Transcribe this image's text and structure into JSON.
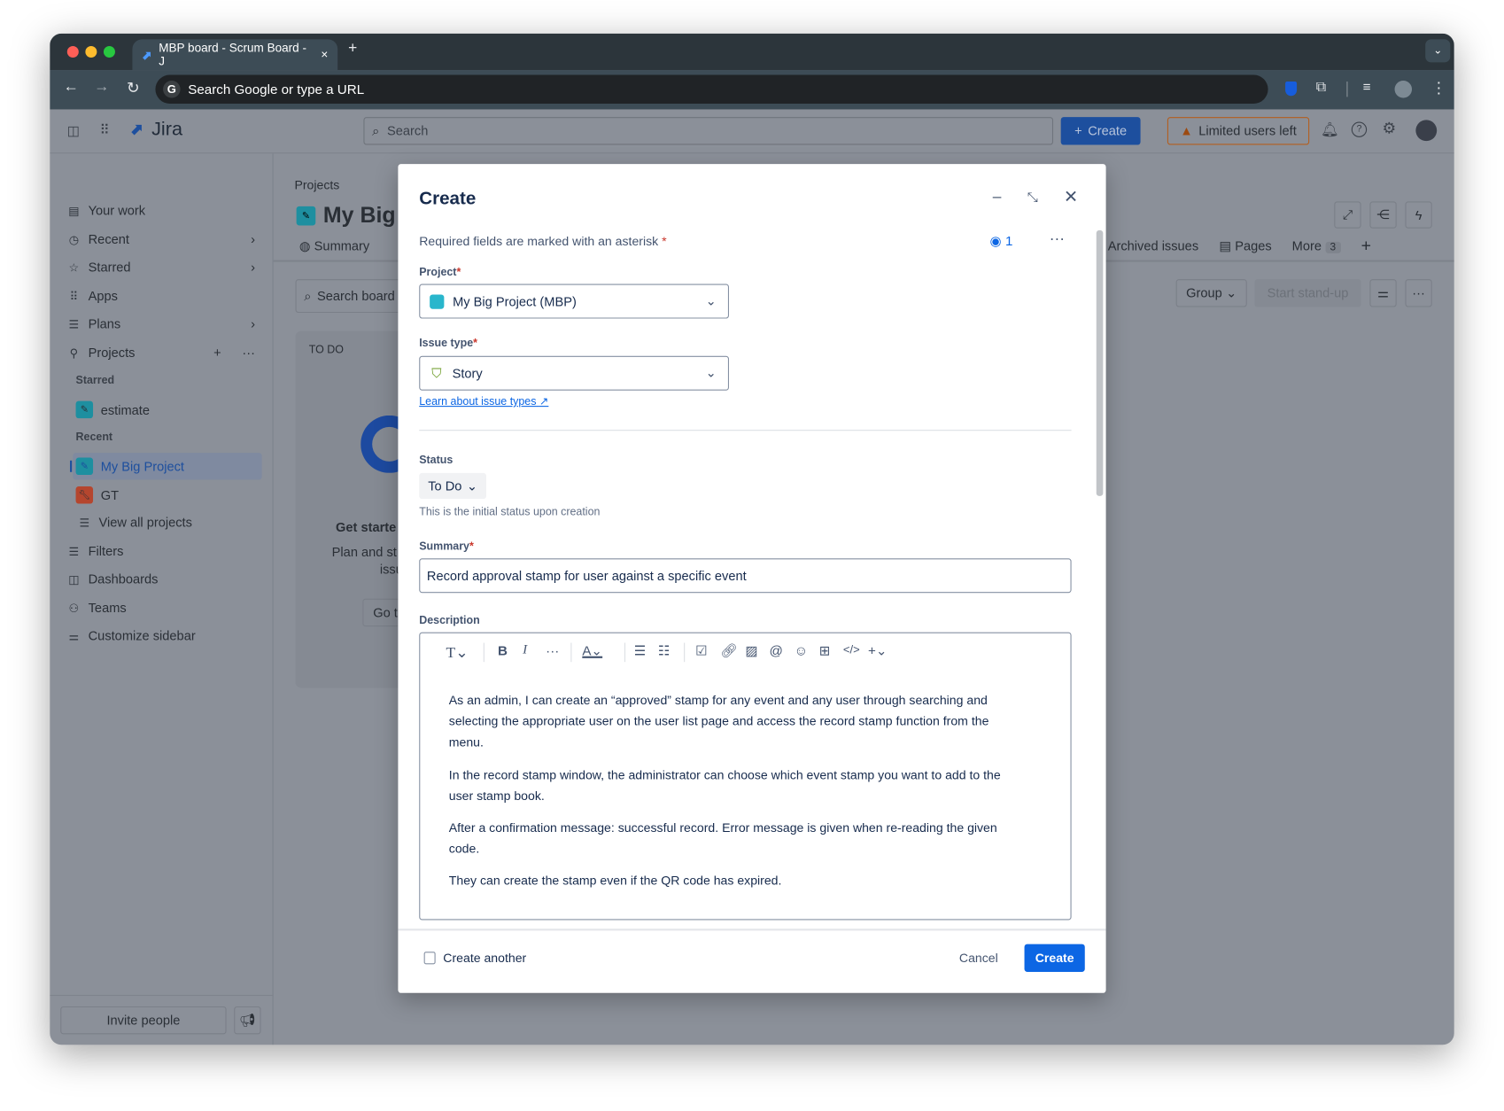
{
  "browser": {
    "tab_title": "MBP board - Scrum Board - J",
    "new_tab": "+",
    "close": "×",
    "omnibox": "Search Google or type a URL"
  },
  "header": {
    "logo": "Jira",
    "search_placeholder": "Search",
    "create": "Create",
    "limited": "Limited users left"
  },
  "sidebar": {
    "items": [
      {
        "label": "Your work"
      },
      {
        "label": "Recent"
      },
      {
        "label": "Starred"
      },
      {
        "label": "Apps"
      },
      {
        "label": "Plans"
      },
      {
        "label": "Projects"
      }
    ],
    "starred_heading": "Starred",
    "starred": [
      "estimate"
    ],
    "recent_heading": "Recent",
    "recent": [
      "My Big Project",
      "GT"
    ],
    "view_all": "View all projects",
    "bottom": [
      {
        "label": "Filters"
      },
      {
        "label": "Dashboards"
      },
      {
        "label": "Teams"
      },
      {
        "label": "Customize sidebar"
      }
    ],
    "invite": "Invite people"
  },
  "main": {
    "breadcrumb": "Projects",
    "title": "My Big P",
    "tab_summary": "Summary",
    "tab_archived": "Archived issues",
    "tab_pages": "Pages",
    "tab_more": "More",
    "more_count": "3",
    "search_board": "Search board",
    "group": "Group",
    "standup": "Start stand-up",
    "column": "TO DO",
    "get_started": "Get starte",
    "plan_text": "Plan and st",
    "plan_text2": "issu",
    "go": "Go t"
  },
  "modal": {
    "title": "Create",
    "required_note": "Required fields are marked with an asterisk",
    "asterisk": "*",
    "watchers": "1",
    "project_label": "Project",
    "project_value": "My Big Project (MBP)",
    "issue_type_label": "Issue type",
    "issue_type_value": "Story",
    "learn_link": "Learn about issue types",
    "status_label": "Status",
    "status_value": "To Do",
    "status_help": "This is the initial status upon creation",
    "summary_label": "Summary",
    "summary_value": "Record approval stamp for user against a specific event",
    "description_label": "Description",
    "description": [
      "As an admin, I can create an “approved” stamp for any event and any user through searching and selecting the appropriate user on the user list page and access the record stamp function from the menu.",
      "In the record stamp window, the administrator can choose which event stamp you want to add to the user stamp book.",
      "After a confirmation message: successful record. Error message is given when re-reading the given code.",
      "They can create the stamp even if the QR code has expired."
    ],
    "create_another": "Create another",
    "cancel": "Cancel",
    "create": "Create"
  },
  "colors": {
    "primary": "#0c66e4",
    "overlay_bg": "#8b9099",
    "warning": "#b35e1f"
  }
}
